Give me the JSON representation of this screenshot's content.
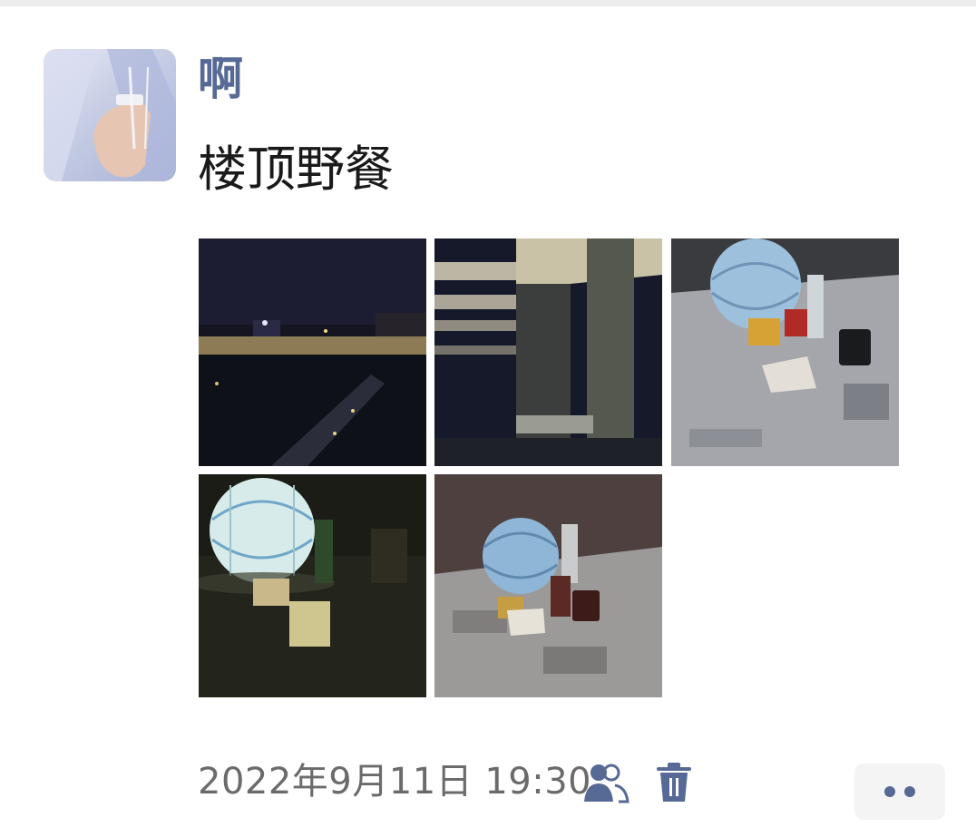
{
  "post": {
    "nickname": "啊",
    "text": "楼顶野餐",
    "timestamp": "2022年9月11日 19:30"
  },
  "photos": [
    {
      "name": "rooftop-night-city-view"
    },
    {
      "name": "rooftop-pillar-night"
    },
    {
      "name": "picnic-lantern-on-newspaper"
    },
    {
      "name": "glowing-lantern-dark"
    },
    {
      "name": "lantern-with-snacks-on-newspaper"
    }
  ],
  "icons": {
    "visibility": "friends-visibility-icon",
    "delete": "trash-icon",
    "more": "more-dots-icon"
  },
  "colors": {
    "nickname": "#566a95",
    "accent_icon": "#566a95",
    "timestamp": "#6b6b6b"
  }
}
